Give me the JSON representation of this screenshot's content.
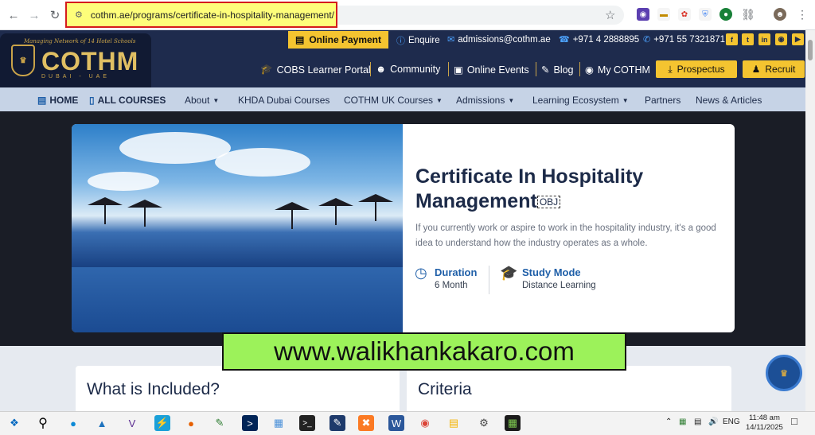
{
  "browser": {
    "url": "cothm.ae/programs/certificate-in-hospitality-management/",
    "icons": [
      "back-arrow-icon",
      "forward-arrow-icon",
      "reload-icon",
      "site-settings-icon",
      "bookmark-star-icon",
      "extensions-icon",
      "browser-menu-icon"
    ]
  },
  "logo": {
    "tagline": "Managing Network of 14 Hotel Schools",
    "name": "COTHM",
    "subtitle": "DUBAI - UAE"
  },
  "topbar": {
    "online_payment": "Online Payment",
    "enquire": "Enquire",
    "email": "admissions@cothm.ae",
    "phone": "+971 4 2888895",
    "whatsapp": "+971 55 7321871",
    "social": [
      "facebook-icon",
      "twitter-icon",
      "linkedin-icon",
      "instagram-icon",
      "youtube-icon"
    ]
  },
  "secondary_nav": {
    "learner_portal": "COBS Learner Portal",
    "community": "Community",
    "online_events": "Online Events",
    "blog": "Blog",
    "my_cothm": "My COTHM",
    "prospectus": "Prospectus",
    "recruit": "Recruit"
  },
  "main_nav": {
    "home": "HOME",
    "all_courses": "ALL COURSES",
    "about": "About",
    "khda": "KHDA Dubai Courses",
    "uk_courses": "COTHM UK Courses",
    "admissions": "Admissions",
    "learning": "Learning Ecosystem",
    "partners": "Partners",
    "news": "News & Articles"
  },
  "hero": {
    "title": "Certificate In Hospitality Management",
    "obj_tag": "OBJ",
    "description": "If you currently work or aspire to work in the hospitality industry, it's a good idea to understand how the industry operates as a whole.",
    "duration_label": "Duration",
    "duration_value": "6 Month",
    "mode_label": "Study Mode",
    "mode_value": "Distance Learning"
  },
  "sections": {
    "included": "What is Included?",
    "criteria": "Criteria"
  },
  "watermark": "www.walikhankakaro.com",
  "taskbar": {
    "lang": "ENG",
    "time": "11:48 am",
    "date": "14/11/2025"
  },
  "colors": {
    "navy": "#1e2b4d",
    "gold": "#f4c430",
    "blue": "#1f5fa8",
    "watermark_green": "#9cf25a",
    "url_highlight": "#fefe7a"
  }
}
